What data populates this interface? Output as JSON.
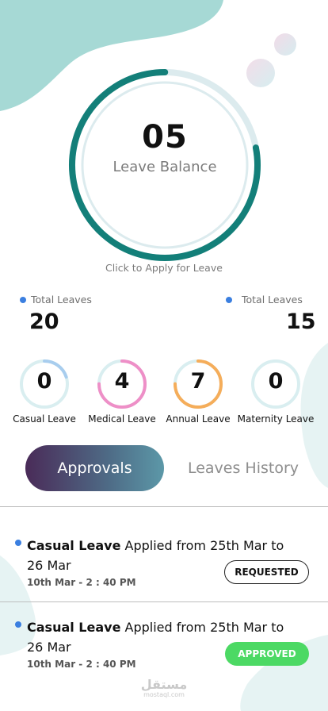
{
  "balance": {
    "value": "05",
    "label": "Leave Balance",
    "fraction": 0.78
  },
  "apply_link": "Click to Apply for Leave",
  "totals": [
    {
      "label": "Total Leaves",
      "value": "20"
    },
    {
      "label": "Total Leaves",
      "value": "15"
    }
  ],
  "leave_types": [
    {
      "name": "Casual Leave",
      "count": "0",
      "color": "#a8cdee",
      "fraction": 0.2
    },
    {
      "name": "Medical Leave",
      "count": "4",
      "color": "#ee8fc7",
      "fraction": 0.75
    },
    {
      "name": "Annual Leave",
      "count": "7",
      "color": "#f5ad5a",
      "fraction": 0.75
    },
    {
      "name": "Maternity Leave",
      "count": "0",
      "color": "#d9eef0",
      "fraction": 0.0
    }
  ],
  "tabs": {
    "active": "Approvals",
    "inactive": "Leaves History"
  },
  "requests": [
    {
      "type": "Casual Leave",
      "text": " Applied from 25th Mar to 26 Mar",
      "time": "10th Mar - 2 : 40 PM",
      "status": "REQUESTED"
    },
    {
      "type": "Casual Leave",
      "text": " Applied from 25th Mar to 26 Mar",
      "time": "10th Mar - 2 : 40 PM",
      "status": "APPROVED"
    }
  ],
  "watermark": {
    "arabic": "مستقل",
    "latin": "mostaql.com"
  },
  "colors": {
    "accent_teal": "#137f79",
    "ring_track": "#dcebee",
    "blob": "#a6d9d5",
    "dot": "#3b7fe0",
    "approved": "#4cd964"
  }
}
